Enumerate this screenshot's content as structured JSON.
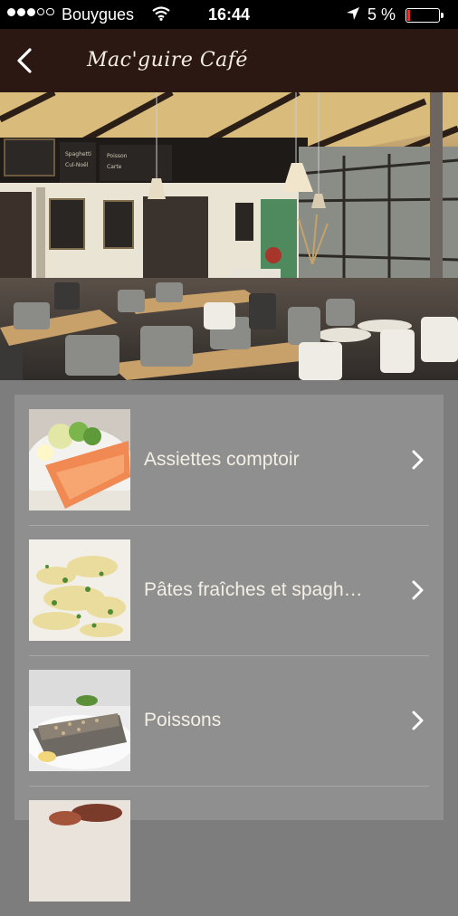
{
  "status_bar": {
    "carrier": "Bouygues",
    "time": "16:44",
    "battery_percent": "5 %",
    "battery_level": 0.05,
    "signal_dots": 5,
    "signal_filled": 3
  },
  "nav": {
    "title": "Mac'guire Café",
    "back_icon": "chevron-left-icon"
  },
  "hero": {
    "icon": "restaurant-interior-photo"
  },
  "menu": {
    "items": [
      {
        "label": "Assiettes comptoir",
        "thumb": "smoked-salmon-plate-photo"
      },
      {
        "label": "Pâtes fraîches et spagh…",
        "thumb": "fresh-pasta-photo"
      },
      {
        "label": "Poissons",
        "thumb": "fish-dish-photo"
      },
      {
        "label": "",
        "thumb": "meat-dish-photo"
      }
    ],
    "chevron_icon": "chevron-right-icon"
  },
  "colors": {
    "navbar": "#2b1813",
    "page_bg": "#7d7d7d",
    "card_bg": "#8f8f8f",
    "label_text": "#f4efe4",
    "battery_low": "#e5352b"
  }
}
